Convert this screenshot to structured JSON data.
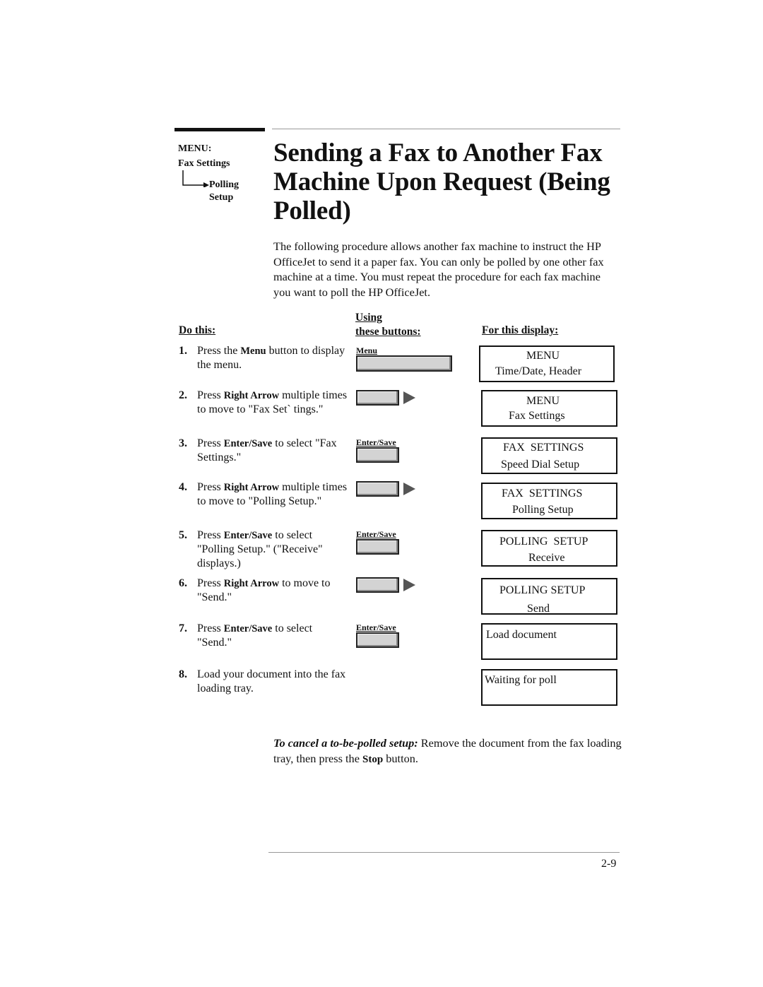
{
  "sidebar": {
    "menu_label": "MENU:",
    "menu_path": "Fax Settings",
    "submenu_line1": "Polling",
    "submenu_line2": "Setup"
  },
  "title": "Sending a Fax to Another Fax Machine Upon Request (Being Polled)",
  "intro": "The following procedure allows another fax machine to instruct the HP OfficeJet to send it a paper fax. You can only be polled by one other fax machine at a time. You must repeat the procedure for each fax machine you want to poll the HP OfficeJet.",
  "table": {
    "col_do": "Do this:",
    "col_using_line1": "Using",
    "col_using_line2": "these buttons:",
    "col_display": "For this display:"
  },
  "steps": [
    {
      "num": "1.",
      "pre": "Press the ",
      "key": "Menu",
      "post": " button to display the menu.",
      "button": {
        "type": "menu",
        "label": "Menu"
      },
      "display": {
        "line1": "MENU",
        "line2": "Time/Date, Header"
      }
    },
    {
      "num": "2.",
      "pre": "Press ",
      "key": "Right Arrow",
      "post": " multiple times to move to \"Fax Set` tings.\"",
      "button": {
        "type": "arrow",
        "label": ""
      },
      "display": {
        "line1": "MENU",
        "line2": "Fax Settings"
      }
    },
    {
      "num": "3.",
      "pre": "Press ",
      "key": "Enter/Save",
      "post": " to select \"Fax Settings.\"",
      "button": {
        "type": "enter",
        "label": "Enter/Save"
      },
      "display": {
        "line1": "FAX  SETTINGS",
        "line2": "Speed Dial Setup"
      }
    },
    {
      "num": "4.",
      "pre": "Press ",
      "key": "Right Arrow",
      "post": " multiple times to move to \"Polling Setup.\"",
      "button": {
        "type": "arrow",
        "label": ""
      },
      "display": {
        "line1": "FAX  SETTINGS",
        "line2": "Polling Setup"
      }
    },
    {
      "num": "5.",
      "pre": "Press ",
      "key": "Enter/Save",
      "post": " to select \"Polling Setup.\" (\"Receive\" displays.)",
      "button": {
        "type": "enter",
        "label": "Enter/Save"
      },
      "display": {
        "line1": "POLLING  SETUP",
        "line2": "Receive"
      }
    },
    {
      "num": "6.",
      "pre": "Press ",
      "key": "Right Arrow",
      "post": " to move to \"Send.\"",
      "button": {
        "type": "arrow",
        "label": ""
      },
      "display": {
        "line1": "POLLING SETUP",
        "line2": "Send"
      }
    },
    {
      "num": "7.",
      "pre": "Press ",
      "key": "Enter/Save",
      "post": " to select \"Send.\"",
      "button": {
        "type": "enter",
        "label": "Enter/Save"
      },
      "display": {
        "line1": "Load document",
        "line2": ""
      }
    },
    {
      "num": "8.",
      "pre": "",
      "key": "",
      "post": "Load your document into the fax loading tray.",
      "button": {
        "type": "none",
        "label": ""
      },
      "display": {
        "line1": "Waiting for poll",
        "line2": ""
      }
    }
  ],
  "note": {
    "lead": "To cancel a to-be-polled setup:",
    "text1": "  Remove the document from the fax loading tray, then press the ",
    "key": "Stop",
    "text2": " button."
  },
  "page_number": "2-9"
}
